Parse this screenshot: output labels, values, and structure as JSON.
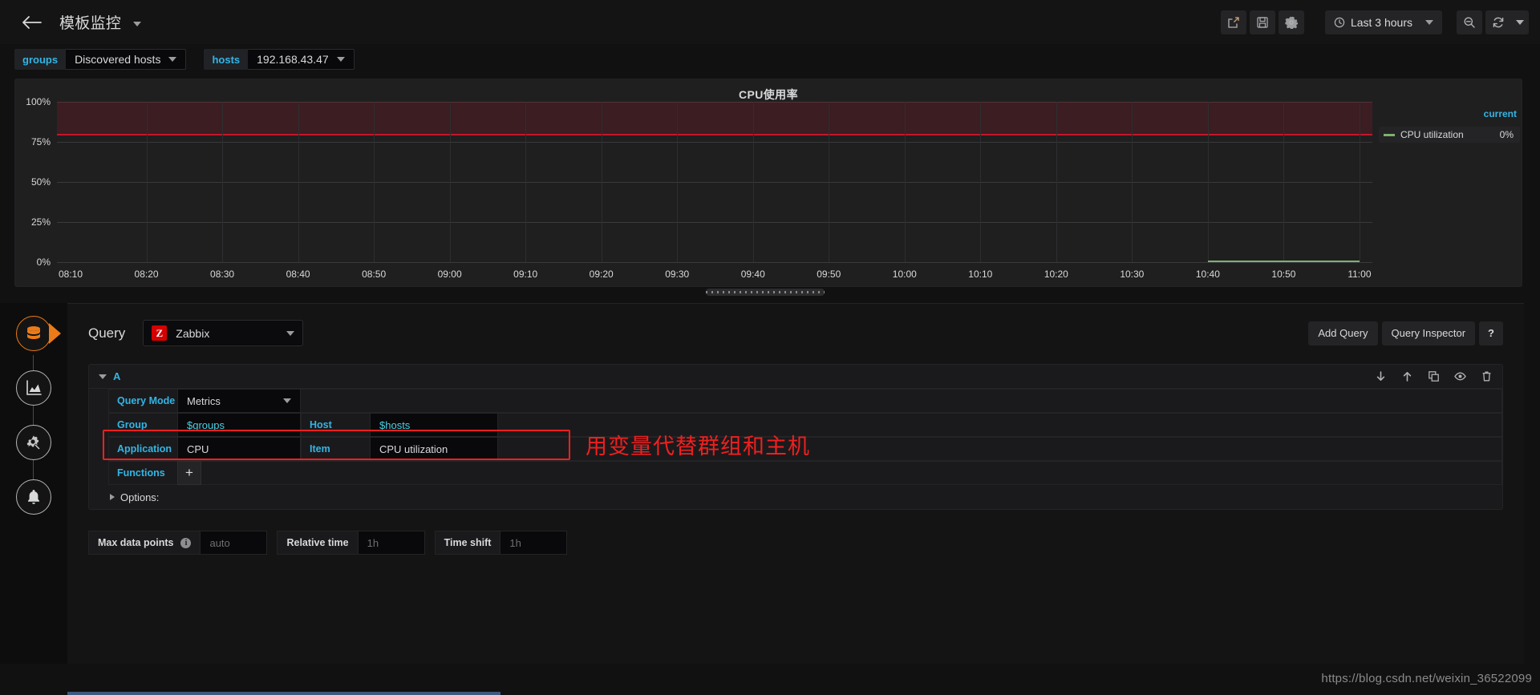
{
  "topnav": {
    "back_icon": "arrow-left-icon",
    "title": "模板监控",
    "share_icon": "share-icon",
    "save_icon": "save-floppy-icon",
    "settings_icon": "gear-icon",
    "time_range": "Last 3 hours",
    "clock_icon": "clock-icon",
    "zoom_out_icon": "zoom-out-icon",
    "refresh_icon": "refresh-icon",
    "refresh_dropdown_icon": "chevron-down-icon"
  },
  "variables": [
    {
      "name": "groups",
      "value": "Discovered hosts"
    },
    {
      "name": "hosts",
      "value": "192.168.43.47"
    }
  ],
  "panel": {
    "title": "CPU使用率",
    "legend_header": "current",
    "legend": [
      {
        "name": "CPU utilization",
        "value": "0%",
        "color": "#7eb26d"
      }
    ]
  },
  "chart_data": {
    "type": "line",
    "title": "CPU使用率",
    "xlabel": "",
    "ylabel": "",
    "ylim": [
      0,
      100
    ],
    "yticks": [
      "0%",
      "25%",
      "50%",
      "75%",
      "100%"
    ],
    "ytick_values": [
      0,
      25,
      50,
      75,
      100
    ],
    "xticks": [
      "08:10",
      "08:20",
      "08:30",
      "08:40",
      "08:50",
      "09:00",
      "09:10",
      "09:20",
      "09:30",
      "09:40",
      "09:50",
      "10:00",
      "10:10",
      "10:20",
      "10:30",
      "10:40",
      "10:50",
      "11:00"
    ],
    "grid": true,
    "legend_position": "right",
    "threshold": {
      "value": 80,
      "color": "#c4162a",
      "fill_color": "rgba(196,22,42,0.18)",
      "fill_to": 100
    },
    "series": [
      {
        "name": "CPU utilization",
        "color": "#7eb26d",
        "current": "0%",
        "x": [
          "10:44",
          "10:47",
          "10:50",
          "10:53",
          "10:56",
          "10:59",
          "11:00"
        ],
        "values": [
          0,
          0,
          0,
          0,
          0,
          0,
          0
        ]
      }
    ]
  },
  "tab_rail": [
    {
      "name": "Queries",
      "icon": "database-icon",
      "active": true
    },
    {
      "name": "Visualization",
      "icon": "graph-icon",
      "active": false
    },
    {
      "name": "General",
      "icon": "gear-wrench-icon",
      "active": false
    },
    {
      "name": "Alert",
      "icon": "bell-icon",
      "active": false
    }
  ],
  "query_editor": {
    "header_label": "Query",
    "datasource": "Zabbix",
    "datasource_logo": "Z",
    "add_query_label": "Add Query",
    "query_inspector_label": "Query Inspector",
    "help_label": "?",
    "ref_id": "A",
    "row_actions": [
      {
        "name": "move-down",
        "icon": "arrow-down-icon"
      },
      {
        "name": "move-up",
        "icon": "arrow-up-icon"
      },
      {
        "name": "duplicate",
        "icon": "copy-icon"
      },
      {
        "name": "toggle-visibility",
        "icon": "eye-icon"
      },
      {
        "name": "remove",
        "icon": "trash-icon"
      }
    ],
    "query_mode_label": "Query Mode",
    "query_mode_value": "Metrics",
    "group_label": "Group",
    "group_value": "$groups",
    "host_label": "Host",
    "host_value": "$hosts",
    "application_label": "Application",
    "application_value": "CPU",
    "item_label": "Item",
    "item_value": "CPU utilization",
    "functions_label": "Functions",
    "functions_add": "+",
    "options_label": "Options:"
  },
  "options_bar": {
    "max_data_points_label": "Max data points",
    "max_data_points_placeholder": "auto",
    "relative_time_label": "Relative time",
    "relative_time_placeholder": "1h",
    "time_shift_label": "Time shift",
    "time_shift_placeholder": "1h"
  },
  "annotation": {
    "text": "用变量代替群组和主机",
    "color": "#f11f1f"
  },
  "watermark": "https://blog.csdn.net/weixin_36522099"
}
